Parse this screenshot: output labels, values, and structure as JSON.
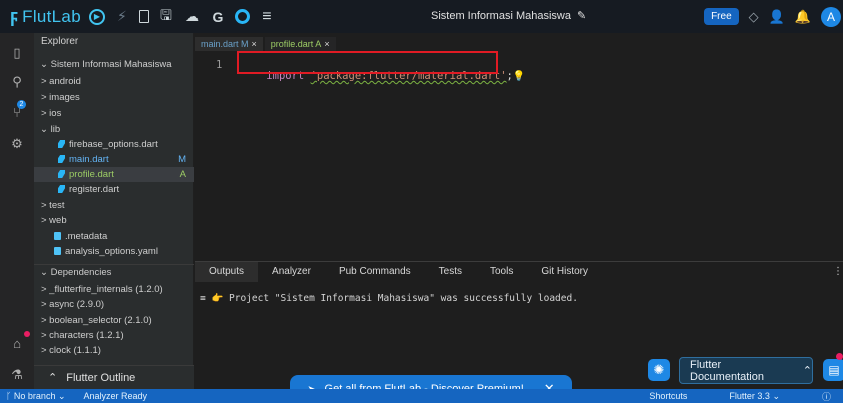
{
  "app": {
    "logo_text": "FlutLab",
    "project_title": "Sistem Informasi Mahasiswa",
    "plan_badge": "Free",
    "avatar_letter": "A"
  },
  "explorer": {
    "header": "Explorer",
    "project_root": "Sistem Informasi Mahasiswa",
    "items": [
      {
        "label": "> android"
      },
      {
        "label": "> images"
      },
      {
        "label": "> ios"
      },
      {
        "label": "lib"
      },
      {
        "label": "firebase_options.dart",
        "suffix": ""
      },
      {
        "label": "main.dart",
        "suffix": "M"
      },
      {
        "label": "profile.dart",
        "suffix": "A"
      },
      {
        "label": "register.dart",
        "suffix": ""
      },
      {
        "label": "> test"
      },
      {
        "label": "> web"
      },
      {
        "label": ".metadata"
      },
      {
        "label": "analysis_options.yaml"
      }
    ],
    "dependencies_header": "Dependencies",
    "dependencies": [
      "> _flutterfire_internals (1.2.0)",
      "> async (2.9.0)",
      "> boolean_selector (2.1.0)",
      "> characters (1.2.1)",
      "> clock (1.1.1)"
    ],
    "outline_label": "Flutter Outline"
  },
  "activity": {
    "source_control_count": "2"
  },
  "editor": {
    "tabs": [
      {
        "label": "main.dart M"
      },
      {
        "label": "profile.dart A"
      }
    ],
    "line_number": "1",
    "code_keyword": "import",
    "code_string": "'package:flutter/material.dart'",
    "code_end": ";"
  },
  "panel": {
    "tabs": [
      "Outputs",
      "Analyzer",
      "Pub Commands",
      "Tests",
      "Tools",
      "Git History"
    ],
    "output_line": "Project \"Sistem Informasi Mahasiswa\" was successfully loaded."
  },
  "floating": {
    "flutter_doc_label": "Flutter Documentation",
    "premium_label": "Get all from FlutLab - Discover Premium!"
  },
  "statusbar": {
    "branch": "No branch",
    "analyzer": "Analyzer Ready",
    "shortcuts": "Shortcuts",
    "flutter_version": "Flutter 3.3"
  }
}
